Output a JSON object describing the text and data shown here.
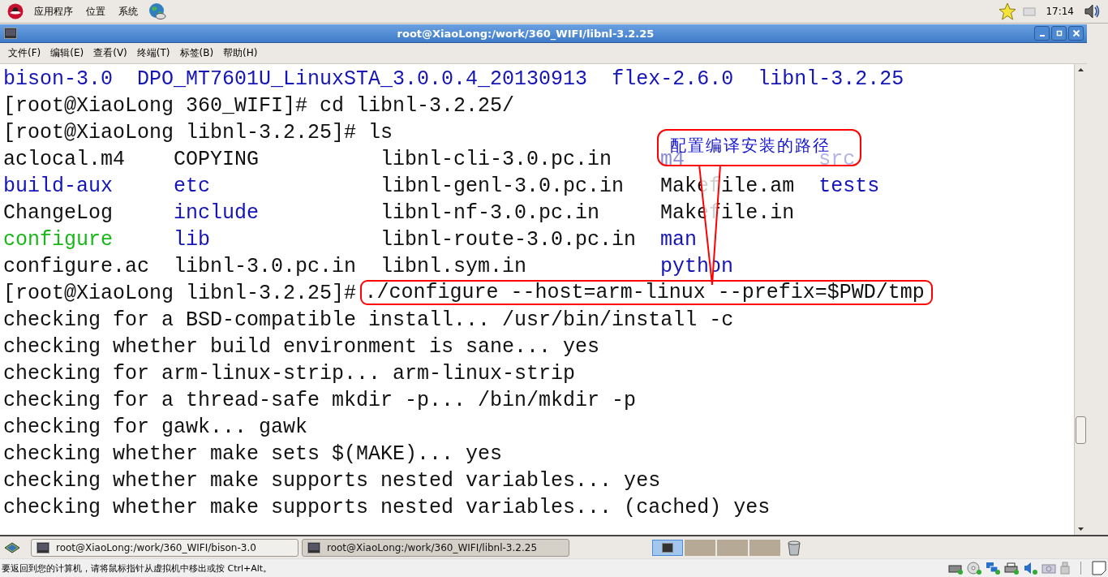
{
  "top_panel": {
    "menus": [
      "应用程序",
      "位置",
      "系统"
    ],
    "clock": "17:14"
  },
  "window": {
    "title": "root@XiaoLong:/work/360_WIFI/libnl-3.2.25"
  },
  "menu_bar": [
    "文件(F)",
    "编辑(E)",
    "查看(V)",
    "终端(T)",
    "标签(B)",
    "帮助(H)"
  ],
  "terminal": {
    "lines": [
      {
        "kind": "list",
        "entries": [
          {
            "name": "bison-3.0",
            "color": "#1414b8"
          },
          {
            "name": "DPO_MT7601U_LinuxSTA_3.0.0.4_20130913",
            "color": "#1414b8"
          },
          {
            "name": "flex-2.6.0",
            "color": "#1414b8"
          },
          {
            "name": "libnl-3.2.25",
            "color": "#1414b8"
          }
        ]
      },
      {
        "kind": "prompt",
        "prompt": "[root@XiaoLong 360_WIFI]#",
        "command": "cd libnl-3.2.25/",
        "highlight": false
      },
      {
        "kind": "prompt",
        "prompt": "[root@XiaoLong libnl-3.2.25]#",
        "command": "ls",
        "highlight": false
      },
      {
        "kind": "grid",
        "entries": [
          {
            "name": "aclocal.m4",
            "color": "#111111"
          },
          {
            "name": "COPYING",
            "color": "#111111"
          },
          {
            "name": "libnl-cli-3.0.pc.in",
            "color": "#111111"
          },
          {
            "name": "m4",
            "color": "#8a8ad8"
          },
          {
            "name": "src",
            "color": "#b4b4e6"
          }
        ]
      },
      {
        "kind": "grid",
        "entries": [
          {
            "name": "build-aux",
            "color": "#1414b8"
          },
          {
            "name": "etc",
            "color": "#1414b8"
          },
          {
            "name": "libnl-genl-3.0.pc.in",
            "color": "#111111"
          },
          {
            "name": "Makefile.am",
            "color": "#111111"
          },
          {
            "name": "tests",
            "color": "#1414b8"
          }
        ]
      },
      {
        "kind": "grid",
        "entries": [
          {
            "name": "ChangeLog",
            "color": "#111111"
          },
          {
            "name": "include",
            "color": "#1414b8"
          },
          {
            "name": "libnl-nf-3.0.pc.in",
            "color": "#111111"
          },
          {
            "name": "Makefile.in",
            "color": "#111111"
          }
        ]
      },
      {
        "kind": "grid",
        "entries": [
          {
            "name": "configure",
            "color": "#18b818"
          },
          {
            "name": "lib",
            "color": "#1414b8"
          },
          {
            "name": "libnl-route-3.0.pc.in",
            "color": "#111111"
          },
          {
            "name": "man",
            "color": "#1414b8"
          }
        ]
      },
      {
        "kind": "grid",
        "entries": [
          {
            "name": "configure.ac",
            "color": "#111111"
          },
          {
            "name": "libnl-3.0.pc.in",
            "color": "#111111"
          },
          {
            "name": "libnl.sym.in",
            "color": "#111111"
          },
          {
            "name": "python",
            "color": "#1414b8"
          }
        ]
      },
      {
        "kind": "prompt",
        "prompt": "[root@XiaoLong libnl-3.2.25]#",
        "command": "./configure --host=arm-linux --prefix=$PWD/tmp",
        "highlight": true
      },
      {
        "kind": "output",
        "text": "checking for a BSD-compatible install... /usr/bin/install -c"
      },
      {
        "kind": "output",
        "text": "checking whether build environment is sane... yes"
      },
      {
        "kind": "output",
        "text": "checking for arm-linux-strip... arm-linux-strip"
      },
      {
        "kind": "output",
        "text": "checking for a thread-safe mkdir -p... /bin/mkdir -p"
      },
      {
        "kind": "output",
        "text": "checking for gawk... gawk"
      },
      {
        "kind": "output",
        "text": "checking whether make sets $(MAKE)... yes"
      },
      {
        "kind": "output",
        "text": "checking whether make supports nested variables... yes"
      },
      {
        "kind": "output",
        "text": "checking whether make supports nested variables... (cached) yes"
      }
    ]
  },
  "callout": {
    "text": "配置编译安装的路径"
  },
  "taskbar": {
    "tasks": [
      {
        "label": "root@XiaoLong:/work/360_WIFI/bison-3.0",
        "selected": false
      },
      {
        "label": "root@XiaoLong:/work/360_WIFI/libnl-3.2.25",
        "selected": true
      }
    ],
    "workspaces": [
      {
        "selected": true
      },
      {
        "selected": false
      },
      {
        "selected": false
      },
      {
        "selected": false
      }
    ]
  },
  "status_bar": {
    "message": "要返回到您的计算机，请将鼠标指针从虚拟机中移出或按 Ctrl+Alt。"
  }
}
